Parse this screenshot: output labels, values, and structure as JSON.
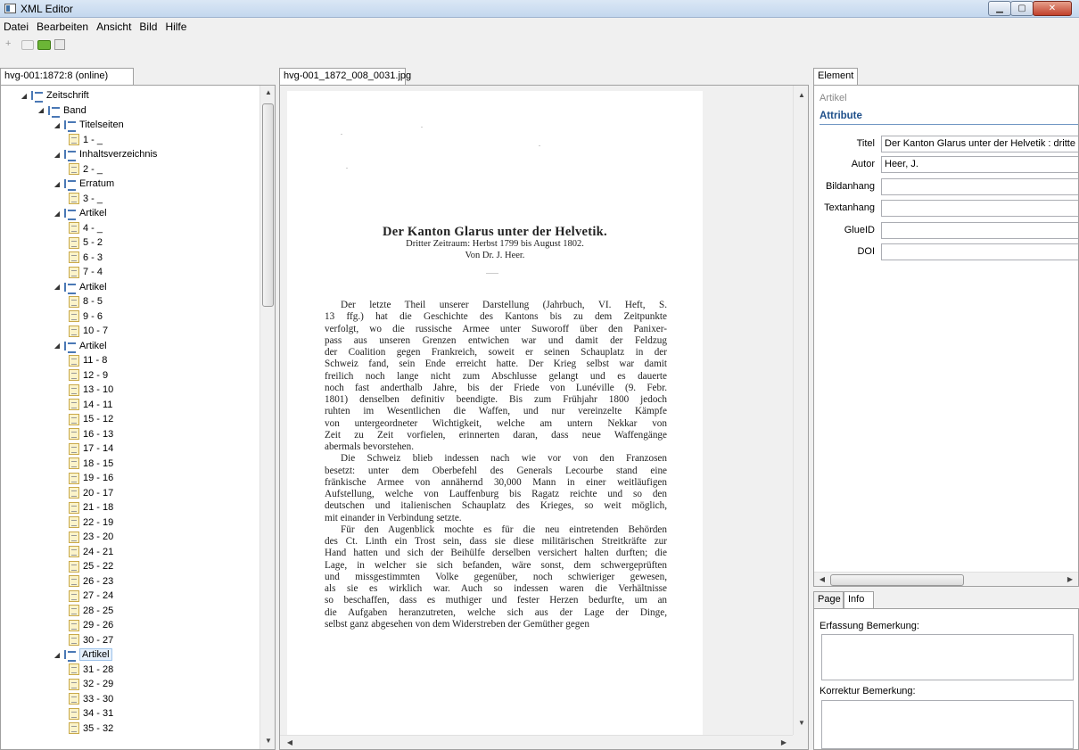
{
  "window": {
    "title": "XML Editor"
  },
  "menu": [
    "Datei",
    "Bearbeiten",
    "Ansicht",
    "Bild",
    "Hilfe"
  ],
  "tree": {
    "tab": "hvg-001:1872:8 (online)",
    "nodes": [
      {
        "label": "Zeitschrift",
        "type": "folder",
        "level": 0
      },
      {
        "label": "Band",
        "type": "folder",
        "level": 1
      },
      {
        "label": "Titelseiten",
        "type": "folder",
        "level": 2
      },
      {
        "label": "1 - _",
        "type": "page",
        "level": 3
      },
      {
        "label": "Inhaltsverzeichnis",
        "type": "folder",
        "level": 2
      },
      {
        "label": "2 - _",
        "type": "page",
        "level": 3
      },
      {
        "label": "Erratum",
        "type": "folder",
        "level": 2
      },
      {
        "label": "3 - _",
        "type": "page",
        "level": 3
      },
      {
        "label": "Artikel",
        "type": "folder",
        "level": 2
      },
      {
        "label": "4 - _",
        "type": "page",
        "level": 3
      },
      {
        "label": "5 - 2",
        "type": "page",
        "level": 3
      },
      {
        "label": "6 - 3",
        "type": "page",
        "level": 3
      },
      {
        "label": "7 - 4",
        "type": "page",
        "level": 3
      },
      {
        "label": "Artikel",
        "type": "folder",
        "level": 2
      },
      {
        "label": "8 - 5",
        "type": "page",
        "level": 3
      },
      {
        "label": "9 - 6",
        "type": "page",
        "level": 3
      },
      {
        "label": "10 - 7",
        "type": "page",
        "level": 3
      },
      {
        "label": "Artikel",
        "type": "folder",
        "level": 2
      },
      {
        "label": "11 - 8",
        "type": "page",
        "level": 3
      },
      {
        "label": "12 - 9",
        "type": "page",
        "level": 3
      },
      {
        "label": "13 - 10",
        "type": "page",
        "level": 3
      },
      {
        "label": "14 - 11",
        "type": "page",
        "level": 3
      },
      {
        "label": "15 - 12",
        "type": "page",
        "level": 3
      },
      {
        "label": "16 - 13",
        "type": "page",
        "level": 3
      },
      {
        "label": "17 - 14",
        "type": "page",
        "level": 3
      },
      {
        "label": "18 - 15",
        "type": "page",
        "level": 3
      },
      {
        "label": "19 - 16",
        "type": "page",
        "level": 3
      },
      {
        "label": "20 - 17",
        "type": "page",
        "level": 3
      },
      {
        "label": "21 - 18",
        "type": "page",
        "level": 3
      },
      {
        "label": "22 - 19",
        "type": "page",
        "level": 3
      },
      {
        "label": "23 - 20",
        "type": "page",
        "level": 3
      },
      {
        "label": "24 - 21",
        "type": "page",
        "level": 3
      },
      {
        "label": "25 - 22",
        "type": "page",
        "level": 3
      },
      {
        "label": "26 - 23",
        "type": "page",
        "level": 3
      },
      {
        "label": "27 - 24",
        "type": "page",
        "level": 3
      },
      {
        "label": "28 - 25",
        "type": "page",
        "level": 3
      },
      {
        "label": "29 - 26",
        "type": "page",
        "level": 3
      },
      {
        "label": "30 - 27",
        "type": "page",
        "level": 3
      },
      {
        "label": "Artikel",
        "type": "folder",
        "level": 2,
        "selected": true
      },
      {
        "label": "31 - 28",
        "type": "page",
        "level": 3
      },
      {
        "label": "32 - 29",
        "type": "page",
        "level": 3
      },
      {
        "label": "33 - 30",
        "type": "page",
        "level": 3
      },
      {
        "label": "34 - 31",
        "type": "page",
        "level": 3
      },
      {
        "label": "35 - 32",
        "type": "page",
        "level": 3
      }
    ]
  },
  "viewer": {
    "tab": "hvg-001_1872_008_0031.jpg",
    "title": "Der Kanton Glarus unter der Helvetik.",
    "subtitle1": "Dritter Zeitraum: Herbst 1799 bis August 1802.",
    "subtitle2": "Von Dr. J. Heer.",
    "lines": [
      "Der letzte Theil unserer Darstellung (Jahrbuch, VI. Heft, S.",
      "13 ffg.) hat die Geschichte des Kantons bis zu dem Zeitpunkte",
      "verfolgt, wo die russische Armee unter Suworoff über den Panixer-",
      "pass aus unseren Grenzen entwichen war und damit der Feldzug",
      "der Coalition gegen Frankreich, soweit er seinen Schauplatz in der",
      "Schweiz fand, sein Ende erreicht hatte. Der Krieg selbst war damit",
      "freilich noch lange nicht zum Abschlusse gelangt und es dauerte",
      "noch fast anderthalb Jahre, bis der Friede von Lunéville (9. Febr.",
      "1801) denselben definitiv beendigte. Bis zum Frühjahr 1800 jedoch",
      "ruhten im Wesentlichen die Waffen, und nur vereinzelte Kämpfe",
      "von untergeordneter Wichtigkeit, welche am untern Nekkar von",
      "Zeit zu Zeit vorfielen, erinnerten daran, dass neue Waffengänge",
      "abermals bevorstehen.",
      "Die Schweiz blieb indessen nach wie vor von den Franzosen",
      "besetzt: unter dem Oberbefehl des Generals Lecourbe stand eine",
      "fränkische Armee von annähernd 30,000 Mann in einer weitläufigen",
      "Aufstellung, welche von Lauffenburg bis Ragatz reichte und so den",
      "deutschen und italienischen Schauplatz des Krieges, so weit möglich,",
      "mit einander in Verbindung setzte.",
      "Für den Augenblick mochte es für die neu eintretenden Behörden",
      "des Ct. Linth ein Trost sein, dass sie diese militärischen Streitkräfte zur",
      "Hand hatten und sich der Beihülfe derselben versichert halten durften; die",
      "Lage, in welcher sie sich befanden, wäre sonst, dem schwergeprüften",
      "und missgestimmten Volke gegenüber, noch schwieriger gewesen,",
      "als sie es wirklich war. Auch so indessen waren die Verhältnisse",
      "so beschaffen, dass es muthiger und fester Herzen bedurfte, um an",
      "die Aufgaben heranzutreten, welche sich aus der Lage der Dinge,",
      "selbst ganz abgesehen von dem Widerstreben der Gemüther gegen"
    ]
  },
  "element": {
    "tab": "Element",
    "type": "Artikel",
    "section": "Attribute",
    "attributes": [
      {
        "label": "Titel",
        "value": "Der Kanton Glarus unter der Helvetik : dritte"
      },
      {
        "label": "Autor",
        "value": "Heer, J."
      },
      {
        "label": "Bildanhang",
        "value": ""
      },
      {
        "label": "Textanhang",
        "value": ""
      },
      {
        "label": "GlueID",
        "value": ""
      },
      {
        "label": "DOI",
        "value": ""
      }
    ]
  },
  "info": {
    "tabs": [
      "Page",
      "Info"
    ],
    "erfassung_label": "Erfassung Bemerkung:",
    "korrektur_label": "Korrektur Bemerkung:"
  }
}
